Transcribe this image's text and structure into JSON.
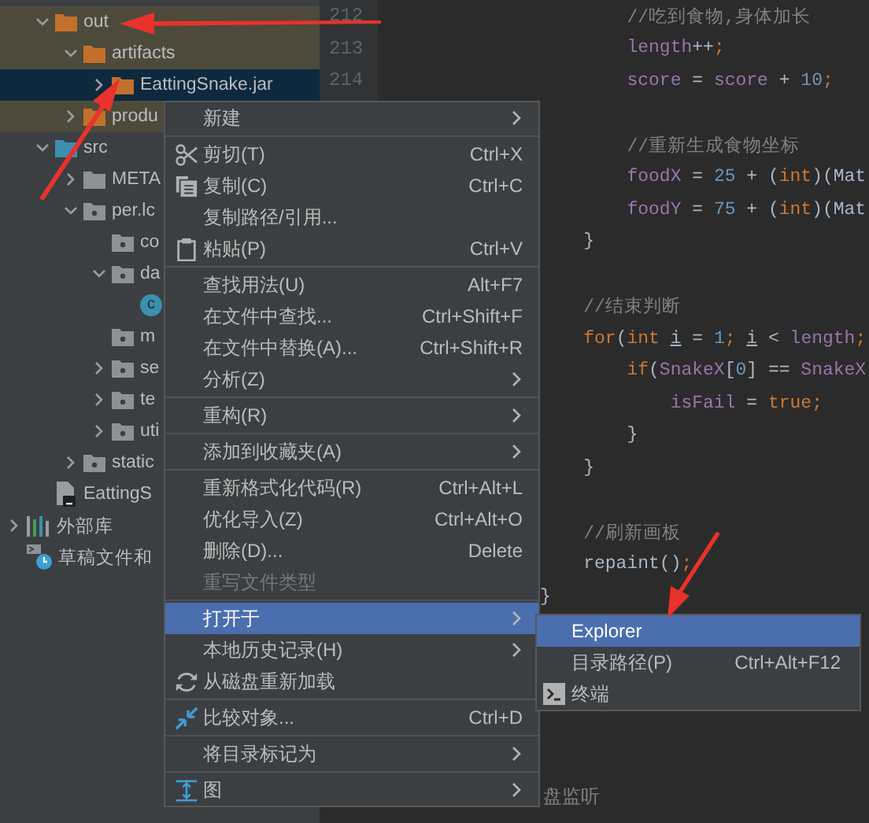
{
  "project_items": [
    {
      "label": "out",
      "kind": "excluded-folder",
      "expanded": true,
      "selected": false,
      "excluded": true,
      "children": [
        {
          "label": "artifacts",
          "kind": "excluded-folder",
          "expanded": true,
          "selected": false,
          "excluded": true,
          "children": [
            {
              "label": "EattingSnake.jar",
              "kind": "excluded-folder",
              "expanded": false,
              "selected": true
            }
          ]
        },
        {
          "label": "produ",
          "kind": "excluded-folder",
          "expanded": false,
          "selected": false,
          "excluded": true
        }
      ]
    },
    {
      "label": "src",
      "kind": "source-folder",
      "expanded": true,
      "selected": false,
      "excluded": false,
      "children": [
        {
          "label": "META",
          "kind": "folder",
          "expanded": false,
          "selected": false,
          "excluded": false
        },
        {
          "label": "per.lc",
          "kind": "package",
          "expanded": true,
          "selected": false,
          "excluded": false,
          "children": [
            {
              "label": "co",
              "kind": "package",
              "selected": false,
              "excluded": false
            },
            {
              "label": "da",
              "kind": "package",
              "expanded": true,
              "selected": false,
              "excluded": false,
              "children": [
                {
                  "badge": "c",
                  "kind": "class",
                  "selected": false,
                  "excluded": false
                }
              ]
            },
            {
              "label": "m",
              "kind": "package",
              "selected": false,
              "excluded": false
            },
            {
              "label": "se",
              "kind": "package",
              "expanded": false,
              "selected": false,
              "excluded": false
            },
            {
              "label": "te",
              "kind": "package",
              "expanded": false,
              "selected": false,
              "excluded": false
            },
            {
              "label": "uti",
              "kind": "package",
              "expanded": false,
              "selected": false,
              "excluded": false
            }
          ]
        },
        {
          "label": "static",
          "kind": "package",
          "expanded": false,
          "selected": false,
          "excluded": false
        }
      ]
    },
    {
      "label": "EattingS",
      "kind": "module-file",
      "selected": false,
      "excluded": false
    }
  ],
  "root_items": [
    {
      "label": "外部库",
      "kind": "libraries",
      "expanded": false,
      "selected": false,
      "excluded": false
    },
    {
      "label": "草稿文件和",
      "kind": "scratches",
      "selected": false,
      "excluded": false
    }
  ],
  "code_lines": [
    {
      "kind": "code",
      "number": "212",
      "tokens": [
        {
          "text": "        //吃到食物,身体加长",
          "kind": "comment"
        }
      ]
    },
    {
      "kind": "code",
      "number": "213",
      "tokens": [
        {
          "text": "        length",
          "kind": "field"
        },
        {
          "text": "++",
          "kind": "plain"
        },
        {
          "text": ";",
          "kind": "keyword"
        }
      ]
    },
    {
      "kind": "code",
      "number": "214",
      "tokens": [
        {
          "text": "        score",
          "kind": "field"
        },
        {
          "text": " = ",
          "kind": "plain"
        },
        {
          "text": "score",
          "kind": "field"
        },
        {
          "text": " + ",
          "kind": "plain"
        },
        {
          "text": "10",
          "kind": "number"
        },
        {
          "text": ";",
          "kind": "keyword"
        }
      ]
    },
    {
      "kind": "blank"
    },
    {
      "kind": "code",
      "tokens": [
        {
          "text": "        //重新生成食物坐标",
          "kind": "comment"
        }
      ]
    },
    {
      "kind": "code",
      "tokens": [
        {
          "text": "        foodX",
          "kind": "field"
        },
        {
          "text": " = ",
          "kind": "plain"
        },
        {
          "text": "25",
          "kind": "number"
        },
        {
          "text": " + (",
          "kind": "plain"
        },
        {
          "text": "int",
          "kind": "keyword"
        },
        {
          "text": ")(Mat",
          "kind": "plain"
        }
      ]
    },
    {
      "kind": "code",
      "tokens": [
        {
          "text": "        foodY",
          "kind": "field"
        },
        {
          "text": " = ",
          "kind": "plain"
        },
        {
          "text": "75",
          "kind": "number"
        },
        {
          "text": " + (",
          "kind": "plain"
        },
        {
          "text": "int",
          "kind": "keyword"
        },
        {
          "text": ")(Mat",
          "kind": "plain"
        }
      ]
    },
    {
      "kind": "code",
      "tokens": [
        {
          "text": "    }",
          "kind": "plain"
        }
      ]
    },
    {
      "kind": "blank"
    },
    {
      "kind": "code",
      "tokens": [
        {
          "text": "    //结束判断",
          "kind": "comment"
        }
      ]
    },
    {
      "kind": "code",
      "tokens": [
        {
          "text": "    for",
          "kind": "keyword"
        },
        {
          "text": "(",
          "kind": "plain"
        },
        {
          "text": "int ",
          "kind": "keyword"
        },
        {
          "text": "i",
          "kind": "variable"
        },
        {
          "text": " = ",
          "kind": "plain"
        },
        {
          "text": "1",
          "kind": "number"
        },
        {
          "text": "; ",
          "kind": "keyword"
        },
        {
          "text": "i",
          "kind": "variable"
        },
        {
          "text": " < ",
          "kind": "plain"
        },
        {
          "text": "length",
          "kind": "field"
        },
        {
          "text": ";",
          "kind": "keyword"
        }
      ]
    },
    {
      "kind": "code",
      "tokens": [
        {
          "text": "        if",
          "kind": "keyword"
        },
        {
          "text": "(",
          "kind": "plain"
        },
        {
          "text": "SnakeX",
          "kind": "field"
        },
        {
          "text": "[",
          "kind": "plain"
        },
        {
          "text": "0",
          "kind": "number"
        },
        {
          "text": "] == ",
          "kind": "plain"
        },
        {
          "text": "SnakeX",
          "kind": "field"
        }
      ]
    },
    {
      "kind": "code",
      "tokens": [
        {
          "text": "            isFail",
          "kind": "field"
        },
        {
          "text": " = ",
          "kind": "plain"
        },
        {
          "text": "true",
          "kind": "keyword"
        },
        {
          "text": ";",
          "kind": "keyword"
        }
      ]
    },
    {
      "kind": "code",
      "tokens": [
        {
          "text": "        }",
          "kind": "plain"
        }
      ]
    },
    {
      "kind": "code",
      "tokens": [
        {
          "text": "    }",
          "kind": "plain"
        }
      ]
    },
    {
      "kind": "blank"
    },
    {
      "kind": "code",
      "tokens": [
        {
          "text": "    //刷新画板",
          "kind": "comment"
        }
      ]
    },
    {
      "kind": "code",
      "tokens": [
        {
          "text": "    repaint()",
          "kind": "plain"
        },
        {
          "text": ";",
          "kind": "keyword"
        }
      ]
    },
    {
      "kind": "code",
      "tokens": [
        {
          "text": "}",
          "kind": "plain"
        }
      ]
    }
  ],
  "partial_comment": "盘监听",
  "context_menu": [
    {
      "kind": "item",
      "label": "新建",
      "submenu": true,
      "selected": false,
      "disabled": false
    },
    {
      "kind": "separator"
    },
    {
      "kind": "cut",
      "label": "剪切(T)",
      "shortcut": "Ctrl+X",
      "submenu": false,
      "selected": false,
      "disabled": false
    },
    {
      "kind": "copy",
      "label": "复制(C)",
      "shortcut": "Ctrl+C",
      "submenu": false,
      "selected": false,
      "disabled": false
    },
    {
      "kind": "item",
      "label": "复制路径/引用...",
      "submenu": false,
      "selected": false,
      "disabled": false
    },
    {
      "kind": "paste",
      "label": "粘贴(P)",
      "shortcut": "Ctrl+V",
      "submenu": false,
      "selected": false,
      "disabled": false
    },
    {
      "kind": "separator"
    },
    {
      "kind": "item",
      "label": "查找用法(U)",
      "shortcut": "Alt+F7",
      "submenu": false,
      "selected": false,
      "disabled": false
    },
    {
      "kind": "item",
      "label": "在文件中查找...",
      "shortcut": "Ctrl+Shift+F",
      "submenu": false,
      "selected": false,
      "disabled": false
    },
    {
      "kind": "item",
      "label": "在文件中替换(A)...",
      "shortcut": "Ctrl+Shift+R",
      "submenu": false,
      "selected": false,
      "disabled": false
    },
    {
      "kind": "item",
      "label": "分析(Z)",
      "submenu": true,
      "selected": false,
      "disabled": false
    },
    {
      "kind": "separator"
    },
    {
      "kind": "item",
      "label": "重构(R)",
      "submenu": true,
      "selected": false,
      "disabled": false
    },
    {
      "kind": "separator"
    },
    {
      "kind": "item",
      "label": "添加到收藏夹(A)",
      "submenu": true,
      "selected": false,
      "disabled": false
    },
    {
      "kind": "separator"
    },
    {
      "kind": "item",
      "label": "重新格式化代码(R)",
      "shortcut": "Ctrl+Alt+L",
      "submenu": false,
      "selected": false,
      "disabled": false
    },
    {
      "kind": "item",
      "label": "优化导入(Z)",
      "shortcut": "Ctrl+Alt+O",
      "submenu": false,
      "selected": false,
      "disabled": false
    },
    {
      "kind": "item",
      "label": "删除(D)...",
      "shortcut": "Delete",
      "submenu": false,
      "selected": false,
      "disabled": false
    },
    {
      "kind": "item",
      "label": "重写文件类型",
      "submenu": false,
      "selected": false,
      "disabled": true
    },
    {
      "kind": "separator"
    },
    {
      "kind": "item",
      "label": "打开于",
      "submenu": true,
      "selected": true,
      "disabled": false
    },
    {
      "kind": "item",
      "label": "本地历史记录(H)",
      "submenu": true,
      "selected": false,
      "disabled": false
    },
    {
      "kind": "reload",
      "label": "从磁盘重新加载",
      "submenu": false,
      "selected": false,
      "disabled": false
    },
    {
      "kind": "separator"
    },
    {
      "kind": "compare",
      "label": "比较对象...",
      "shortcut": "Ctrl+D",
      "submenu": false,
      "selected": false,
      "disabled": false
    },
    {
      "kind": "separator"
    },
    {
      "kind": "item",
      "label": "将目录标记为",
      "submenu": true,
      "selected": false,
      "disabled": false
    },
    {
      "kind": "separator"
    },
    {
      "kind": "diagram",
      "label": "图",
      "submenu": true,
      "selected": false,
      "disabled": false
    }
  ],
  "submenu": [
    {
      "kind": "item",
      "label": "Explorer",
      "selected": true
    },
    {
      "kind": "item",
      "label": "目录路径(P)",
      "shortcut": "Ctrl+Alt+F12",
      "selected": false
    },
    {
      "kind": "terminal",
      "label": "终端",
      "selected": false
    }
  ]
}
